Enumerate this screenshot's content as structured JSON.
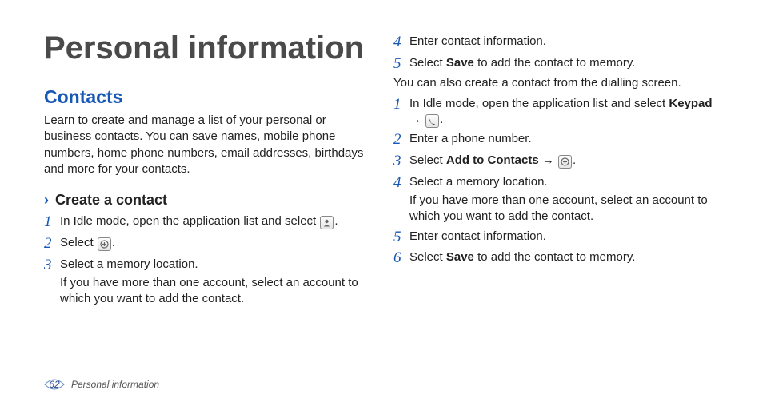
{
  "title": "Personal information",
  "section": {
    "heading": "Contacts",
    "intro": "Learn to create and manage a list of your personal or business contacts. You can save names, mobile phone numbers, home phone numbers, email addresses, birthdays and more for your contacts.",
    "subheading": "Create a contact"
  },
  "left_steps": [
    {
      "num": "1",
      "pre": "In Idle mode, open the application list and select ",
      "icon": "contacts-icon",
      "post": "."
    },
    {
      "num": "2",
      "pre": "Select ",
      "icon": "create-icon",
      "post": "."
    },
    {
      "num": "3",
      "pre": "Select a memory location.",
      "note": "If you have more than one account, select an account to which you want to add the contact."
    }
  ],
  "right_first_steps": [
    {
      "num": "4",
      "pre": "Enter contact information."
    },
    {
      "num": "5",
      "pre": "Select ",
      "bold": "Save",
      "post": " to add the contact to memory."
    }
  ],
  "right_paragraph": "You can also create a contact from the dialling screen.",
  "right_second_steps": [
    {
      "num": "1",
      "pre": "In Idle mode, open the application list and select ",
      "icon": "phone-icon",
      "post_arrow": " → ",
      "bold": "Keypad",
      "post": "."
    },
    {
      "num": "2",
      "pre": "Enter a phone number."
    },
    {
      "num": "3",
      "pre": "Select ",
      "bold": "Add to Contacts",
      "post_arrow": " → ",
      "icon_after": "create-icon",
      "post": "."
    },
    {
      "num": "4",
      "pre": "Select a memory location.",
      "note": "If you have more than one account, select an account to which you want to add the contact."
    },
    {
      "num": "5",
      "pre": "Enter contact information."
    },
    {
      "num": "6",
      "pre": "Select ",
      "bold": "Save",
      "post": " to add the contact to memory."
    }
  ],
  "footer": {
    "page_number": "62",
    "label": "Personal information"
  }
}
